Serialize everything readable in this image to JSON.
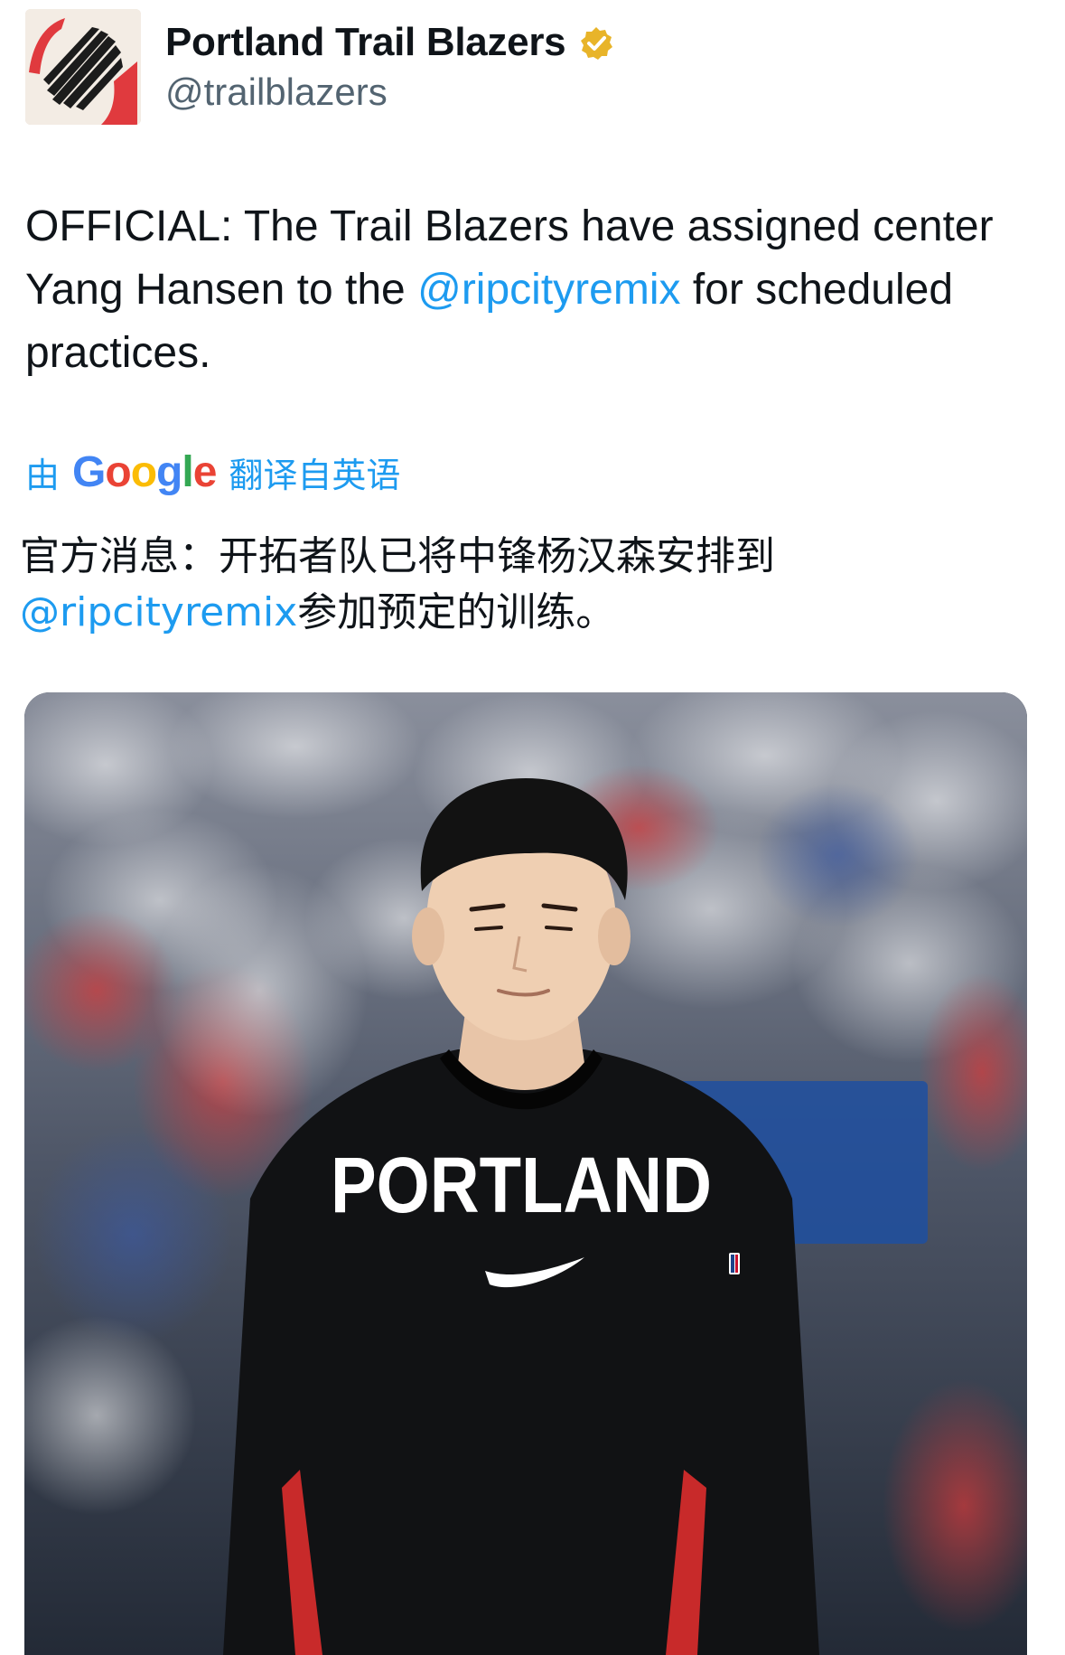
{
  "account": {
    "display_name": "Portland Trail Blazers",
    "handle": "@trailblazers",
    "verified_badge_icon": "verified-gold-badge-icon",
    "avatar_icon": "trail-blazers-logo-icon"
  },
  "tweet": {
    "text_before": "OFFICIAL: The Trail Blazers have assigned center Yang Hansen to the ",
    "mention": "@ripcityremix",
    "text_after": " for scheduled practices."
  },
  "translation_header": {
    "prefix": "由",
    "provider": "Google",
    "suffix": "翻译自英语"
  },
  "translation": {
    "text_before": "官方消息：开拓者队已将中锋杨汉森安排到",
    "mention": "@ripcityremix",
    "text_after": "参加预定的训练。"
  },
  "media": {
    "jersey_text": "PORTLAND"
  },
  "colors": {
    "link": "#1d9bf0",
    "text": "#0f1419",
    "secondary_text": "#536471",
    "verified": "#e8b429",
    "blazers_red": "#e03a3e"
  }
}
